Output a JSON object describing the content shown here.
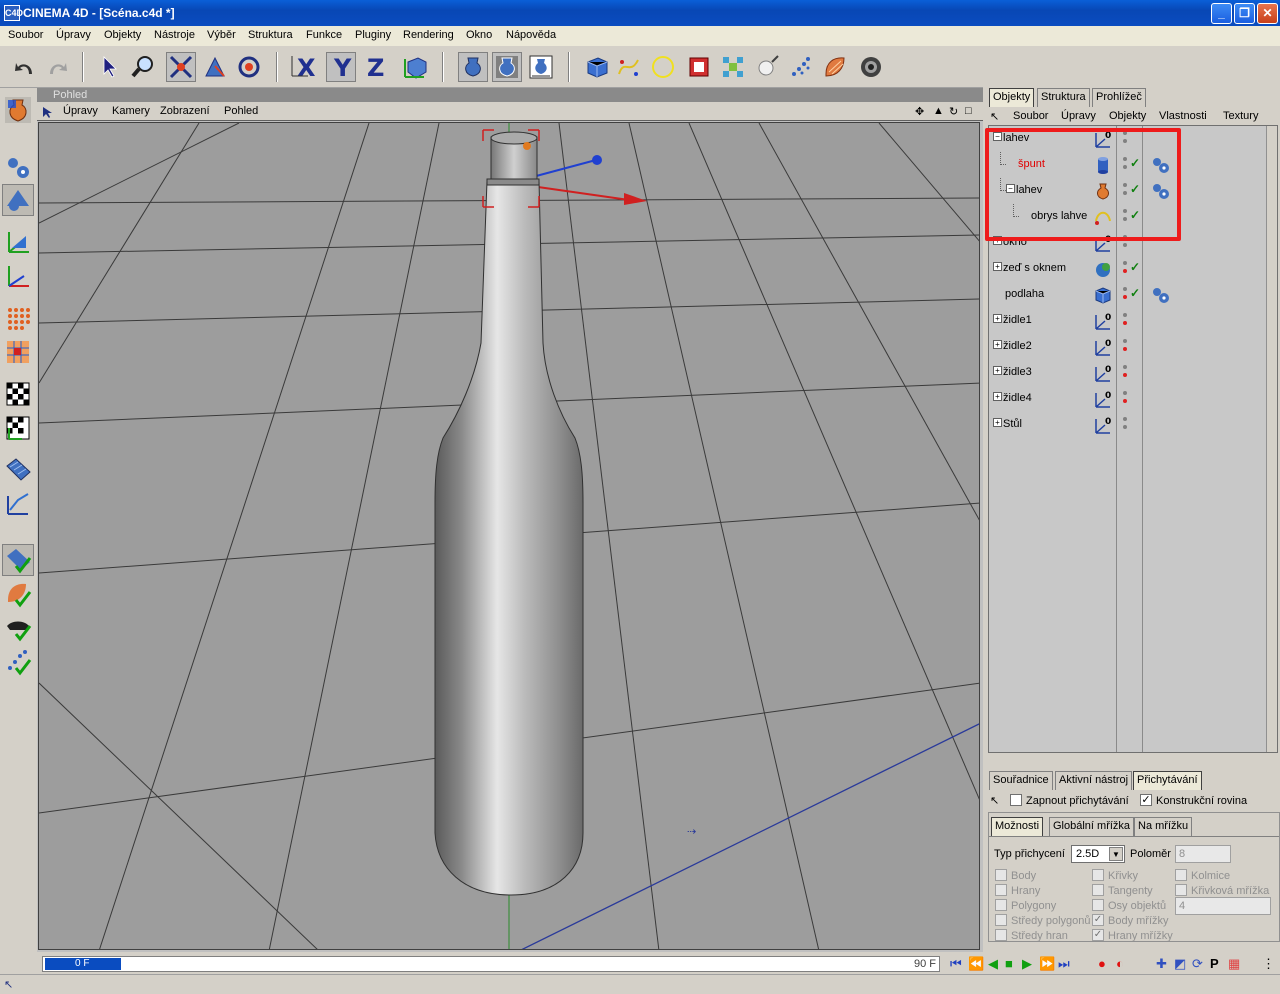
{
  "titlebar": {
    "title": "CINEMA 4D - [Scéna.c4d *]",
    "app_icon": "C4D"
  },
  "menubar": {
    "items": [
      "Soubor",
      "Úpravy",
      "Objekty",
      "Nástroje",
      "Výběr",
      "Struktura",
      "Funkce",
      "Pluginy",
      "Rendering",
      "Okno",
      "Nápověda"
    ]
  },
  "viewport": {
    "title": "Pohled",
    "menu": [
      "Úpravy",
      "Kamery",
      "Zobrazení",
      "Pohled"
    ]
  },
  "object_manager": {
    "tabs": [
      "Objekty",
      "Struktura",
      "Prohlížeč"
    ],
    "menu": [
      "Soubor",
      "Úpravy",
      "Objekty",
      "Vlastnosti",
      "Textury"
    ],
    "objects": [
      {
        "name": "lahev",
        "indent": 0,
        "expander": "−",
        "icon": "null-icon",
        "color": "#000000",
        "dot1": "grey",
        "check": false,
        "tags": false
      },
      {
        "name": "špunt",
        "indent": 1,
        "expander": "",
        "icon": "cylinder-icon",
        "color": "#e00000",
        "dot1": "grey",
        "check": true,
        "tags": true
      },
      {
        "name": "lahev",
        "indent": 1,
        "expander": "−",
        "icon": "lathe-nurbs-icon",
        "color": "#000000",
        "dot1": "grey",
        "check": true,
        "tags": true
      },
      {
        "name": "obrys lahve",
        "indent": 2,
        "expander": "",
        "icon": "spline-icon",
        "color": "#000000",
        "dot1": "grey",
        "check": true,
        "tags": false
      },
      {
        "name": "okno",
        "indent": 0,
        "expander": "+",
        "icon": "null-icon",
        "color": "#000000",
        "dot1": "grey",
        "check": false,
        "tags": false
      },
      {
        "name": "zeď s oknem",
        "indent": 0,
        "expander": "+",
        "icon": "boole-icon",
        "color": "#000000",
        "dot1": "red",
        "check": true,
        "tags": false
      },
      {
        "name": "podlaha",
        "indent": 0,
        "expander": "",
        "icon": "cube-icon",
        "color": "#000000",
        "dot1": "red",
        "check": true,
        "tags": true
      },
      {
        "name": "židle1",
        "indent": 0,
        "expander": "+",
        "icon": "null-icon",
        "color": "#000000",
        "dot1": "red",
        "check": false,
        "tags": false
      },
      {
        "name": "židle2",
        "indent": 0,
        "expander": "+",
        "icon": "null-icon",
        "color": "#000000",
        "dot1": "red",
        "check": false,
        "tags": false
      },
      {
        "name": "židle3",
        "indent": 0,
        "expander": "+",
        "icon": "null-icon",
        "color": "#000000",
        "dot1": "red",
        "check": false,
        "tags": false
      },
      {
        "name": "židle4",
        "indent": 0,
        "expander": "+",
        "icon": "null-icon",
        "color": "#000000",
        "dot1": "red",
        "check": false,
        "tags": false
      },
      {
        "name": "Stůl",
        "indent": 0,
        "expander": "+",
        "icon": "null-icon",
        "color": "#000000",
        "dot1": "grey",
        "check": false,
        "tags": false
      }
    ]
  },
  "attributes": {
    "tabs": [
      "Souřadnice",
      "Aktivní nástroj",
      "Přichytávání"
    ],
    "snap_enable_label": "Zapnout přichytávání",
    "snap_enable_checked": false,
    "work_plane_label": "Konstrukční rovina",
    "work_plane_checked": true,
    "subtabs": [
      "Možnosti",
      "Globální mřížka",
      "Na mřížku"
    ],
    "snap_type_label": "Typ přichycení",
    "snap_type_value": "2.5D",
    "radius_label": "Poloměr",
    "radius_value": "8",
    "col1": [
      "Body",
      "Hrany",
      "Polygony",
      "Středy polygonů",
      "Středy hran"
    ],
    "col2": [
      "Křivky",
      "Tangenty",
      "Osy objektů",
      "Body mřížky",
      "Hrany mřížky"
    ],
    "col2_checked": [
      false,
      false,
      false,
      true,
      true
    ],
    "col3": [
      "Kolmice",
      "Křivková mřížka"
    ],
    "col3_value": "4"
  },
  "timeline": {
    "current_frame": "0 F",
    "end_frame": "90 F"
  },
  "colors": {
    "highlight_box": "#ee1b1b",
    "titlebar": "#0a5fd8"
  }
}
